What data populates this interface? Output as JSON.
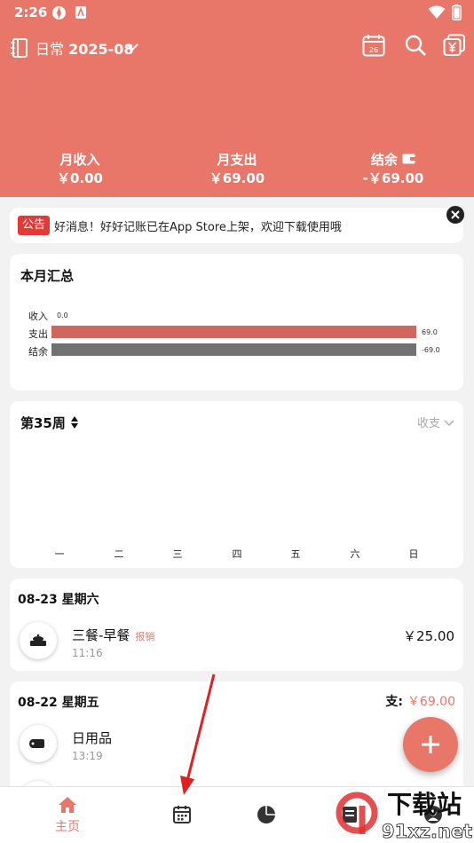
{
  "status": {
    "time": "2:26"
  },
  "header": {
    "title_prefix": "日常",
    "title_month": "2025-08",
    "calendar_day": "26",
    "summary": [
      {
        "label": "月收入",
        "value": "￥0.00"
      },
      {
        "label": "月支出",
        "value": "￥69.00"
      },
      {
        "label": "结余",
        "value": "-￥69.00"
      }
    ]
  },
  "notice": {
    "tag": "公告",
    "text": "好消息！好好记账已在App Store上架，欢迎下载使用哦"
  },
  "monthly": {
    "title": "本月汇总",
    "labels": [
      "收入",
      "支出",
      "结余"
    ]
  },
  "chart_data": {
    "type": "bar",
    "orientation": "horizontal",
    "categories": [
      "收入",
      "支出",
      "结余"
    ],
    "values": [
      0.0,
      69.0,
      -69.0
    ],
    "data_labels": [
      "0.0",
      "69.0",
      "-69.0"
    ],
    "colors": [
      "#d0675e",
      "#d0675e",
      "#727272"
    ],
    "title": "本月汇总"
  },
  "week": {
    "title": "第35周",
    "mode": "收支",
    "days": [
      "一",
      "二",
      "三",
      "四",
      "五",
      "六",
      "日"
    ]
  },
  "days": [
    {
      "date": "08-23 星期六",
      "items": [
        {
          "name": "三餐-早餐",
          "tag": "报销",
          "time": "11:16",
          "amount": "￥25.00",
          "icon": "meal-icon"
        }
      ]
    },
    {
      "date": "08-22 星期五",
      "total_label": "支:",
      "total": "￥69.00",
      "items": [
        {
          "name": "日用品",
          "time": "13:19",
          "icon": "tissue-roll-icon"
        }
      ]
    }
  ],
  "nav": {
    "home": "主页"
  },
  "watermark": {
    "text1": "下载站",
    "text2": "91xz.net"
  },
  "colors": {
    "primary": "#e8776a",
    "expense_bar": "#d0675e",
    "balance_bar": "#727272",
    "notice_tag": "#e53935",
    "annotation_arrow": "#e02020"
  }
}
